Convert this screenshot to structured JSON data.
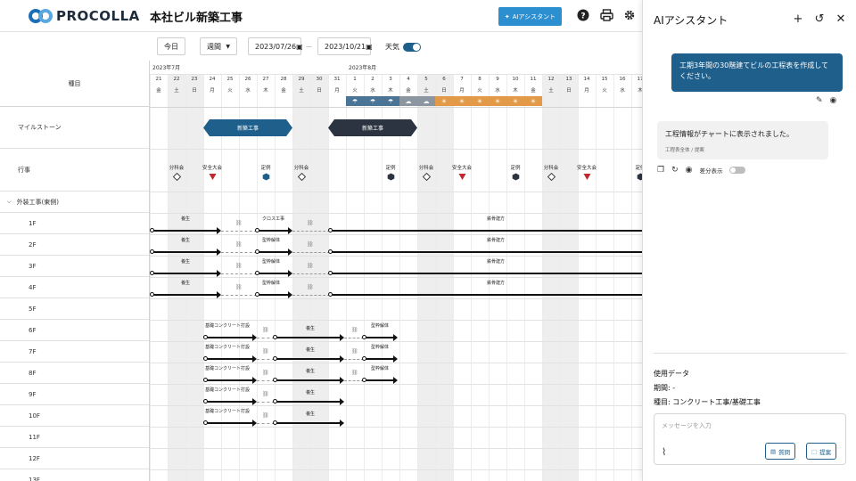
{
  "header": {
    "logo_text": "PROCOLLA",
    "project_title": "本社ビル新築工事",
    "ai_button": "AIアシスタント"
  },
  "toolbar": {
    "today": "今日",
    "view_select": "週間",
    "start_date": "2023/07/26",
    "range_sep": "—",
    "end_date": "2023/10/21",
    "weather_label": "天気",
    "weather_on": true
  },
  "left": {
    "category_header": "種目",
    "milestone": "マイルストーン",
    "events": "行事",
    "group": "外装工事(東側)",
    "floors": [
      "1F",
      "2F",
      "3F",
      "4F",
      "5F",
      "6F",
      "7F",
      "8F",
      "9F",
      "10F",
      "11F",
      "12F",
      "13F"
    ]
  },
  "calendar": {
    "months": [
      "2023年7月",
      "2023年8月"
    ],
    "days": [
      {
        "d": "21",
        "w": "金",
        "wk": false,
        "wx": ""
      },
      {
        "d": "22",
        "w": "土",
        "wk": true,
        "wx": ""
      },
      {
        "d": "23",
        "w": "日",
        "wk": true,
        "wx": ""
      },
      {
        "d": "24",
        "w": "月",
        "wk": false,
        "wx": ""
      },
      {
        "d": "25",
        "w": "火",
        "wk": false,
        "wx": ""
      },
      {
        "d": "26",
        "w": "水",
        "wk": false,
        "wx": ""
      },
      {
        "d": "27",
        "w": "木",
        "wk": false,
        "wx": ""
      },
      {
        "d": "28",
        "w": "金",
        "wk": false,
        "wx": ""
      },
      {
        "d": "29",
        "w": "土",
        "wk": true,
        "wx": ""
      },
      {
        "d": "30",
        "w": "日",
        "wk": true,
        "wx": ""
      },
      {
        "d": "31",
        "w": "月",
        "wk": false,
        "wx": ""
      },
      {
        "d": "1",
        "w": "火",
        "wk": false,
        "wx": "rain"
      },
      {
        "d": "2",
        "w": "水",
        "wk": false,
        "wx": "rain"
      },
      {
        "d": "3",
        "w": "木",
        "wk": false,
        "wx": "rain"
      },
      {
        "d": "4",
        "w": "金",
        "wk": false,
        "wx": "cloud"
      },
      {
        "d": "5",
        "w": "土",
        "wk": true,
        "wx": "cloud"
      },
      {
        "d": "6",
        "w": "日",
        "wk": true,
        "wx": "sun"
      },
      {
        "d": "7",
        "w": "月",
        "wk": false,
        "wx": "sun"
      },
      {
        "d": "8",
        "w": "火",
        "wk": false,
        "wx": "sun"
      },
      {
        "d": "9",
        "w": "水",
        "wk": false,
        "wx": "sun"
      },
      {
        "d": "10",
        "w": "木",
        "wk": false,
        "wx": "sun"
      },
      {
        "d": "11",
        "w": "金",
        "wk": false,
        "wx": "sun"
      },
      {
        "d": "12",
        "w": "土",
        "wk": true,
        "wx": ""
      },
      {
        "d": "13",
        "w": "日",
        "wk": true,
        "wx": ""
      },
      {
        "d": "14",
        "w": "月",
        "wk": false,
        "wx": ""
      },
      {
        "d": "15",
        "w": "火",
        "wk": false,
        "wx": ""
      },
      {
        "d": "16",
        "w": "水",
        "wk": false,
        "wx": ""
      },
      {
        "d": "17",
        "w": "木",
        "wk": false,
        "wx": ""
      }
    ],
    "milestones": [
      {
        "label": "新築工事",
        "start": 3,
        "end": 8,
        "color": "#1f5f8b"
      },
      {
        "label": "新築工事",
        "start": 10,
        "end": 15,
        "color": "#2b3440"
      }
    ],
    "events": [
      {
        "label": "分科会",
        "day": 1,
        "shape": "diamond"
      },
      {
        "label": "安全大会",
        "day": 3,
        "shape": "triangle"
      },
      {
        "label": "定例",
        "day": 6,
        "shape": "hex-blue"
      },
      {
        "label": "分科会",
        "day": 8,
        "shape": "diamond"
      },
      {
        "label": "定例",
        "day": 13,
        "shape": "hex"
      },
      {
        "label": "分科会",
        "day": 15,
        "shape": "diamond"
      },
      {
        "label": "安全大会",
        "day": 17,
        "shape": "triangle"
      },
      {
        "label": "定例",
        "day": 20,
        "shape": "hex"
      },
      {
        "label": "分科会",
        "day": 22,
        "shape": "diamond"
      },
      {
        "label": "安全大会",
        "day": 24,
        "shape": "triangle"
      },
      {
        "label": "定例",
        "day": 27,
        "shape": "hex"
      }
    ],
    "tasks": {
      "upper": [
        {
          "a": "養生",
          "b": "クロス工事",
          "c": "鉄骨建方"
        },
        {
          "a": "養生",
          "b": "型枠解体",
          "c": "鉄骨建方"
        },
        {
          "a": "養生",
          "b": "型枠解体",
          "c": "鉄骨建方"
        },
        {
          "a": "養生",
          "b": "型枠解体",
          "c": "鉄骨建方"
        }
      ],
      "lower": [
        {
          "a": "基礎コンクリート打設",
          "b": "養生",
          "c": "型枠解体"
        },
        {
          "a": "基礎コンクリート打設",
          "b": "養生",
          "c": "型枠解体"
        },
        {
          "a": "基礎コンクリート打設",
          "b": "養生",
          "c": "型枠解体"
        },
        {
          "a": "基礎コンクリート打設",
          "b": "養生",
          "c": ""
        },
        {
          "a": "基礎コンクリート打設",
          "b": "養生",
          "c": ""
        }
      ]
    }
  },
  "panel": {
    "title": "AIアシスタント",
    "user_message": "工期3年間の30階建てビルの工程表を作成してください。",
    "ai_message": "工程情報がチャートに表示されました。",
    "ai_meta": "工程表全体 / 提案",
    "diff_label": "差分表示",
    "usage_title": "使用データ",
    "period": "期間: -",
    "category": "種目: コンクリート工事/基礎工事",
    "input_placeholder": "メッセージを入力",
    "question_button": "質問",
    "propose_button": "提案"
  }
}
